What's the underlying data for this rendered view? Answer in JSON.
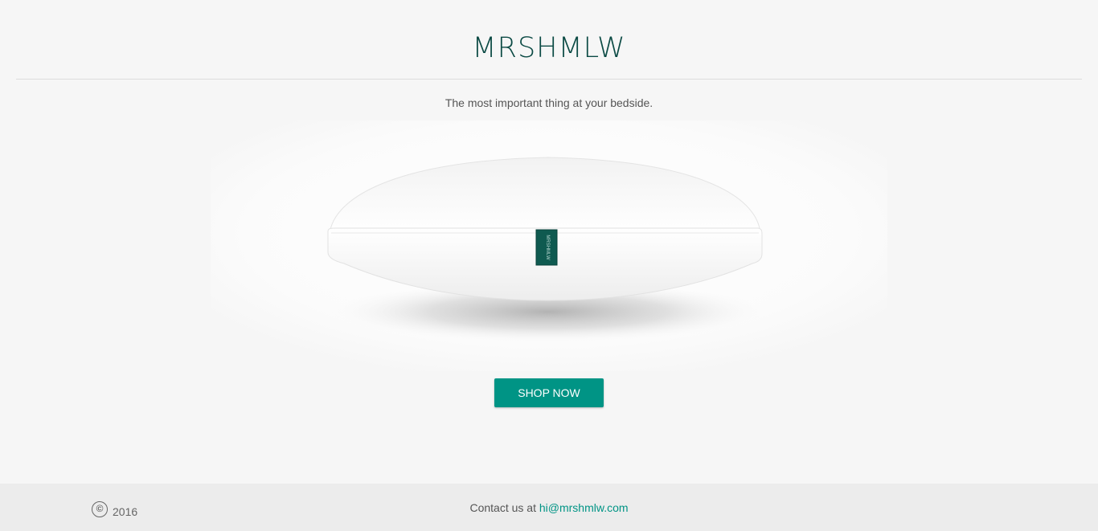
{
  "header": {
    "logo_text": "MRSHMLW"
  },
  "hero": {
    "tagline": "The most important thing at your bedside.",
    "pillow_label_text": "MRSHMLW",
    "cta_label": "SHOP NOW"
  },
  "footer": {
    "copyright_symbol": "©",
    "copyright_year": "2016",
    "contact_prefix": "Contact us at",
    "contact_email": "hi@mrshmlw.com"
  },
  "colors": {
    "brand_dark": "#0b4a44",
    "accent": "#009485",
    "background": "#f6f6f6",
    "footer_background": "#ececec"
  }
}
